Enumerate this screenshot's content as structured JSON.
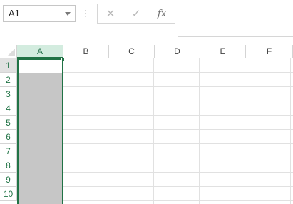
{
  "formula_bar": {
    "name_box": "A1",
    "cancel_symbol": "✕",
    "enter_symbol": "✓",
    "fx_label": "fx",
    "formula_value": ""
  },
  "grid": {
    "columns": [
      "A",
      "B",
      "C",
      "D",
      "E",
      "F"
    ],
    "rows": [
      "1",
      "2",
      "3",
      "4",
      "5",
      "6",
      "7",
      "8",
      "9",
      "10"
    ],
    "selected_column": "A",
    "active_cell": "A1",
    "selection_range": "A1:A10"
  },
  "colors": {
    "accent": "#217346",
    "selected_header": "#d3ecdf",
    "selection_fill": "#c6c6c6"
  }
}
